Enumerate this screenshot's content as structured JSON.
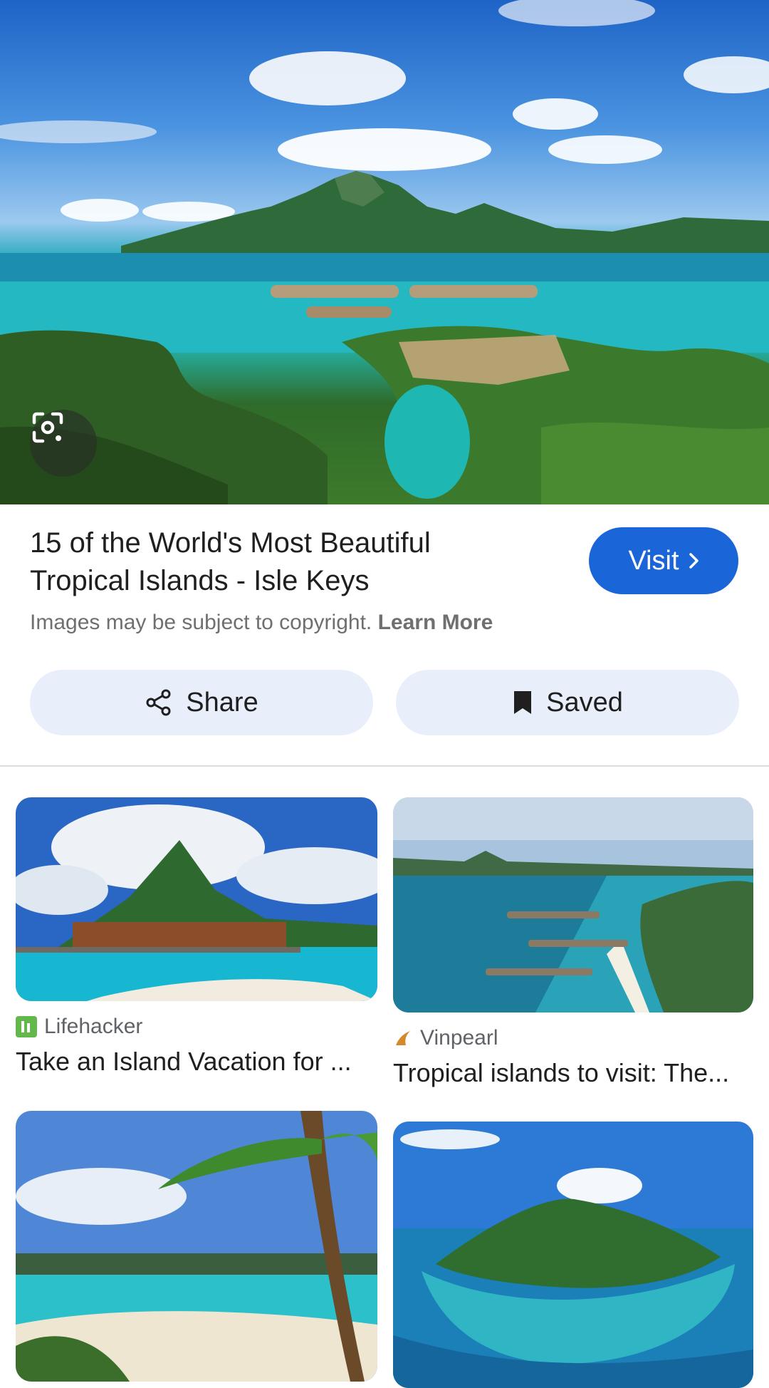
{
  "result": {
    "title": "15 of the World's Most Beautiful Tropical Islands - Isle Keys",
    "visit_label": "Visit",
    "copyright_text": "Images may be subject to copyright.",
    "learn_more_label": "Learn More",
    "share_label": "Share",
    "saved_label": "Saved"
  },
  "related": [
    {
      "source": "Lifehacker",
      "caption": "Take an Island Vacation for ..."
    },
    {
      "source": "Vinpearl",
      "caption": "Tropical islands to visit: The..."
    },
    {
      "source": "",
      "caption": ""
    },
    {
      "source": "",
      "caption": ""
    }
  ],
  "icons": {
    "lens": "google-lens-icon",
    "visit_chevron": "chevron-right-icon",
    "share": "share-icon",
    "saved": "bookmark-icon",
    "lifehacker": "lifehacker-favicon",
    "vinpearl": "vinpearl-favicon"
  },
  "colors": {
    "accent": "#1a66d9",
    "pill_bg": "#e8effb",
    "secondary_text": "#6f6f6f"
  }
}
